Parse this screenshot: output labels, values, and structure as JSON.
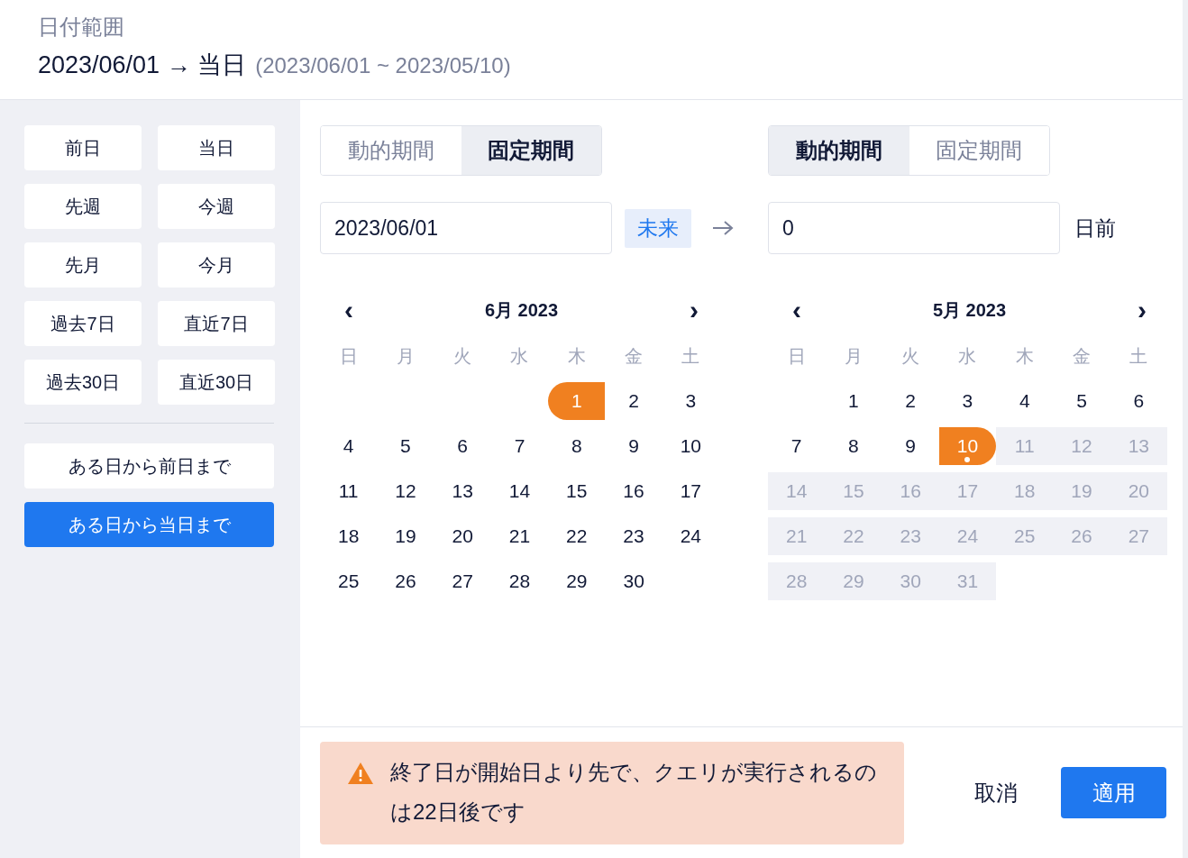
{
  "header": {
    "label": "日付範囲",
    "range_main": "2023/06/01 → 当日",
    "range_detail": "(2023/06/01 ~ 2023/05/10)"
  },
  "presets": [
    {
      "label": "前日",
      "selected": false
    },
    {
      "label": "当日",
      "selected": false
    },
    {
      "label": "先週",
      "selected": false
    },
    {
      "label": "今週",
      "selected": false
    },
    {
      "label": "先月",
      "selected": false
    },
    {
      "label": "今月",
      "selected": false
    },
    {
      "label": "過去7日",
      "selected": false
    },
    {
      "label": "直近7日",
      "selected": false
    },
    {
      "label": "過去30日",
      "selected": false
    },
    {
      "label": "直近30日",
      "selected": false
    }
  ],
  "range_presets": [
    {
      "label": "ある日から前日まで",
      "selected": false
    },
    {
      "label": "ある日から当日まで",
      "selected": true
    }
  ],
  "start": {
    "tabs": [
      {
        "label": "動的期間",
        "selected": false
      },
      {
        "label": "固定期間",
        "selected": true
      }
    ],
    "value": "2023/06/01",
    "badge": "未来",
    "calendar": {
      "title": "6月 2023",
      "prev": "‹",
      "next": "›",
      "weekdays": [
        "日",
        "月",
        "火",
        "水",
        "木",
        "金",
        "土"
      ],
      "weeks": [
        [
          {
            "label": "1",
            "kind": "start",
            "today": false
          },
          {
            "label": "2",
            "kind": "normal",
            "today": false
          },
          {
            "label": "3",
            "kind": "normal",
            "today": false
          }
        ],
        [
          {
            "label": "4",
            "kind": "normal",
            "today": false
          },
          {
            "label": "5",
            "kind": "normal",
            "today": false
          },
          {
            "label": "6",
            "kind": "normal",
            "today": false
          },
          {
            "label": "7",
            "kind": "normal",
            "today": false
          },
          {
            "label": "8",
            "kind": "normal",
            "today": false
          },
          {
            "label": "9",
            "kind": "normal",
            "today": false
          },
          {
            "label": "10",
            "kind": "normal",
            "today": false
          }
        ],
        [
          {
            "label": "11",
            "kind": "normal",
            "today": false
          },
          {
            "label": "12",
            "kind": "normal",
            "today": false
          },
          {
            "label": "13",
            "kind": "normal",
            "today": false
          },
          {
            "label": "14",
            "kind": "normal",
            "today": false
          },
          {
            "label": "15",
            "kind": "normal",
            "today": false
          },
          {
            "label": "16",
            "kind": "normal",
            "today": false
          },
          {
            "label": "17",
            "kind": "normal",
            "today": false
          }
        ],
        [
          {
            "label": "18",
            "kind": "normal",
            "today": false
          },
          {
            "label": "19",
            "kind": "normal",
            "today": false
          },
          {
            "label": "20",
            "kind": "normal",
            "today": false
          },
          {
            "label": "21",
            "kind": "normal",
            "today": false
          },
          {
            "label": "22",
            "kind": "normal",
            "today": false
          },
          {
            "label": "23",
            "kind": "normal",
            "today": false
          },
          {
            "label": "24",
            "kind": "normal",
            "today": false
          }
        ],
        [
          {
            "label": "25",
            "kind": "normal",
            "today": false
          },
          {
            "label": "26",
            "kind": "normal",
            "today": false
          },
          {
            "label": "27",
            "kind": "normal",
            "today": false
          },
          {
            "label": "28",
            "kind": "normal",
            "today": false
          },
          {
            "label": "29",
            "kind": "normal",
            "today": false
          },
          {
            "label": "30",
            "kind": "normal",
            "today": false
          }
        ]
      ]
    }
  },
  "end": {
    "tabs": [
      {
        "label": "動的期間",
        "selected": true
      },
      {
        "label": "固定期間",
        "selected": false
      }
    ],
    "value": "0",
    "unit": "日前",
    "calendar": {
      "title": "5月 2023",
      "prev": "‹",
      "next": "›",
      "weekdays": [
        "日",
        "月",
        "火",
        "水",
        "木",
        "金",
        "土"
      ],
      "weeks": [
        [
          {
            "label": "1",
            "kind": "normal",
            "today": false
          },
          {
            "label": "2",
            "kind": "normal",
            "today": false
          },
          {
            "label": "3",
            "kind": "normal",
            "today": false
          },
          {
            "label": "4",
            "kind": "normal",
            "today": false
          },
          {
            "label": "5",
            "kind": "normal",
            "today": false
          },
          {
            "label": "6",
            "kind": "normal",
            "today": false
          }
        ],
        [
          {
            "label": "7",
            "kind": "normal",
            "today": false
          },
          {
            "label": "8",
            "kind": "normal",
            "today": false
          },
          {
            "label": "9",
            "kind": "normal",
            "today": false
          },
          {
            "label": "10",
            "kind": "end",
            "today": true
          },
          {
            "label": "11",
            "kind": "range",
            "today": false
          },
          {
            "label": "12",
            "kind": "range",
            "today": false
          },
          {
            "label": "13",
            "kind": "range",
            "today": false
          }
        ],
        [
          {
            "label": "14",
            "kind": "range",
            "today": false
          },
          {
            "label": "15",
            "kind": "range",
            "today": false
          },
          {
            "label": "16",
            "kind": "range",
            "today": false
          },
          {
            "label": "17",
            "kind": "range",
            "today": false
          },
          {
            "label": "18",
            "kind": "range",
            "today": false
          },
          {
            "label": "19",
            "kind": "range",
            "today": false
          },
          {
            "label": "20",
            "kind": "range",
            "today": false
          }
        ],
        [
          {
            "label": "21",
            "kind": "range",
            "today": false
          },
          {
            "label": "22",
            "kind": "range",
            "today": false
          },
          {
            "label": "23",
            "kind": "range",
            "today": false
          },
          {
            "label": "24",
            "kind": "range",
            "today": false
          },
          {
            "label": "25",
            "kind": "range",
            "today": false
          },
          {
            "label": "26",
            "kind": "range",
            "today": false
          },
          {
            "label": "27",
            "kind": "range",
            "today": false
          }
        ],
        [
          {
            "label": "28",
            "kind": "range",
            "today": false
          },
          {
            "label": "29",
            "kind": "range",
            "today": false
          },
          {
            "label": "30",
            "kind": "range",
            "today": false
          },
          {
            "label": "31",
            "kind": "range",
            "today": false
          }
        ]
      ]
    }
  },
  "warning": "終了日が開始日より先で、クエリが実行されるのは22日後です",
  "buttons": {
    "cancel": "取消",
    "apply": "適用"
  }
}
